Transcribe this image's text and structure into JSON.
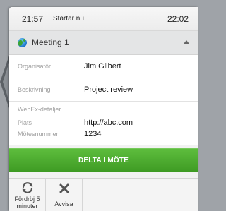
{
  "reminder": {
    "start_time": "21:57",
    "status": "Startar nu",
    "end_time": "22:02"
  },
  "meeting": {
    "title": "Meeting 1",
    "icon": "globe-icon",
    "expand_icon": "chevron-up-icon"
  },
  "details": {
    "organizer_label": "Organisatör",
    "organizer_value": "Jim Gilbert",
    "description_label": "Beskrivning",
    "description_value": "Project review",
    "webex_header": "WebEx-detaljer",
    "location_label": "Plats",
    "location_value": "http://abc.com",
    "meeting_number_label": "Mötesnummer",
    "meeting_number_value": "1234"
  },
  "join_button": {
    "label": "DELTA I MÖTE",
    "color": "#4aaa2e"
  },
  "actions": {
    "snooze_line1": "Fördröj 5",
    "snooze_line2": "minuter",
    "snooze_icon": "refresh-icon",
    "dismiss_label": "Avvisa",
    "dismiss_icon": "close-icon"
  }
}
